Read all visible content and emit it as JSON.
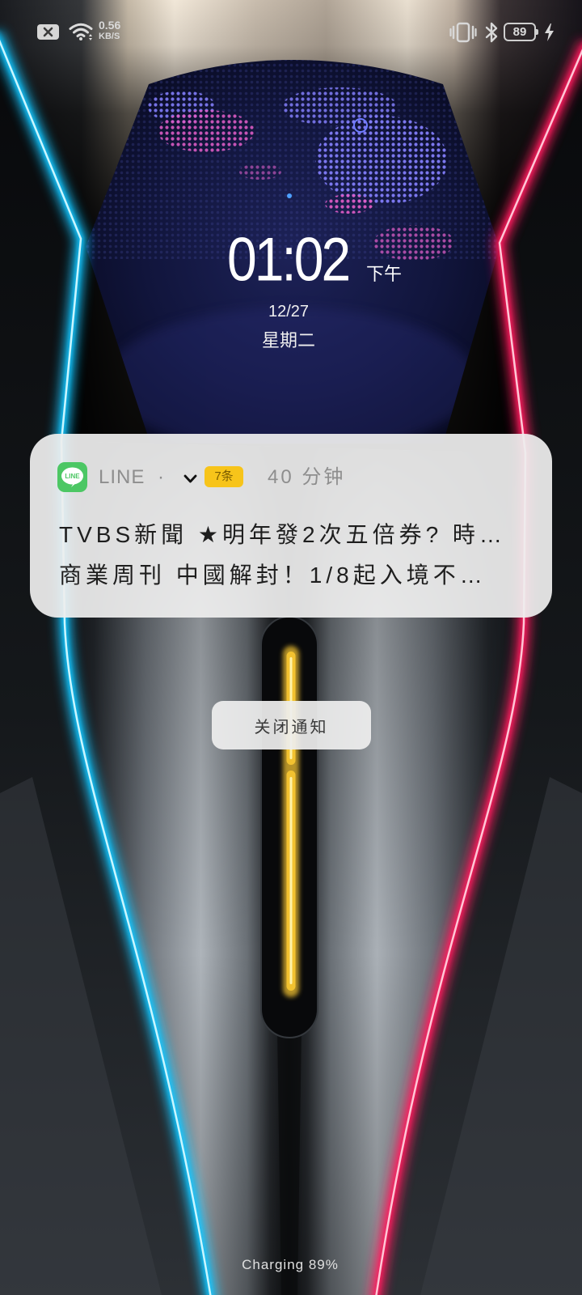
{
  "status_bar": {
    "net_speed_value": "0.56",
    "net_speed_unit": "KB/S",
    "battery_level": "89",
    "icons": {
      "sim": "no-sim-icon",
      "wifi": "wifi-icon",
      "vibrate": "vibrate-icon",
      "bluetooth": "bluetooth-icon",
      "battery": "battery-icon",
      "charging": "charging-bolt-icon"
    }
  },
  "lock_screen": {
    "time": "01:02",
    "period": "下午",
    "date": "12/27",
    "weekday": "星期二"
  },
  "notification": {
    "app_icon": "line-app-icon",
    "app_icon_text": "LINE",
    "app_name": "LINE",
    "separator": "·",
    "expand_icon": "chevron-down-icon",
    "count_badge": "7条",
    "time_ago": "40 分钟",
    "messages": [
      "TVBS新聞 ★明年發2次五倍券? 時…",
      "商業周刊 中國解封！1/8起入境不…"
    ]
  },
  "dismiss_button": {
    "label": "关闭通知"
  },
  "charging_status": "Charging 89%",
  "colors": {
    "line_green": "#4cc764",
    "badge_yellow": "#f7c41a",
    "neon_blue": "#19c6ff",
    "neon_red": "#ff1f5e",
    "light_bar_yellow": "#f2c230"
  }
}
